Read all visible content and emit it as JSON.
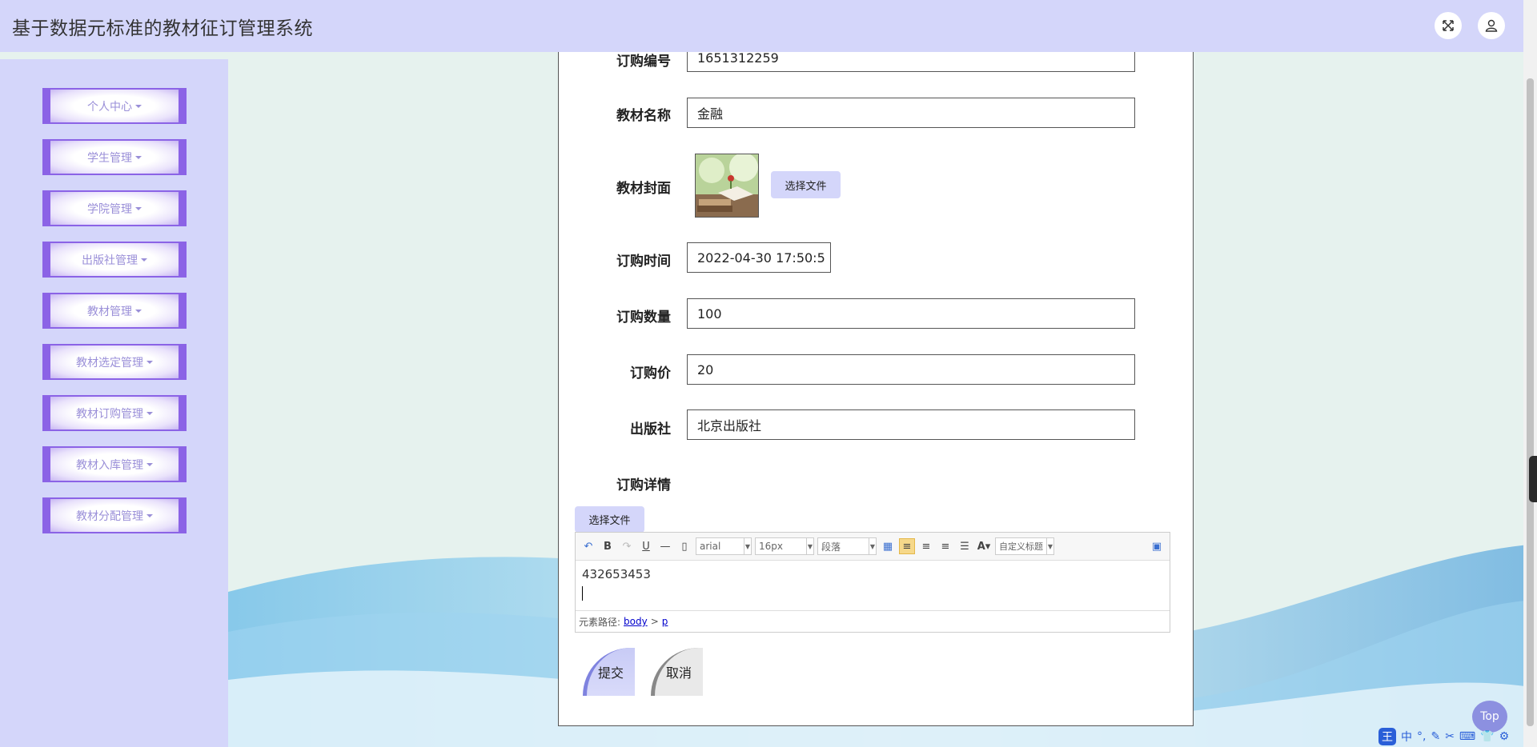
{
  "app": {
    "title": "基于数据元标准的教材征订管理系统"
  },
  "header": {
    "fullscreen_icon": "fullscreen-icon",
    "user_icon": "user-icon"
  },
  "sidebar": {
    "items": [
      {
        "label": "个人中心"
      },
      {
        "label": "学生管理"
      },
      {
        "label": "学院管理"
      },
      {
        "label": "出版社管理"
      },
      {
        "label": "教材管理"
      },
      {
        "label": "教材选定管理"
      },
      {
        "label": "教材订购管理"
      },
      {
        "label": "教材入库管理"
      },
      {
        "label": "教材分配管理"
      }
    ]
  },
  "form": {
    "order_no": {
      "label": "订购编号",
      "value": "1651312259"
    },
    "book_name": {
      "label": "教材名称",
      "value": "金融"
    },
    "cover": {
      "label": "教材封面",
      "button": "选择文件"
    },
    "order_time": {
      "label": "订购时间",
      "value": "2022-04-30 17:50:5"
    },
    "quantity": {
      "label": "订购数量",
      "value": "100"
    },
    "price": {
      "label": "订购价",
      "value": "20"
    },
    "publisher": {
      "label": "出版社",
      "value": "北京出版社"
    },
    "details": {
      "label": "订购详情",
      "button": "选择文件"
    }
  },
  "editor": {
    "font_family": "arial",
    "font_size": "16px",
    "paragraph": "段落",
    "custom_title": "自定义标题",
    "content": "432653453",
    "path_label": "元素路径:",
    "path_body": "body",
    "path_sep": ">",
    "path_p": "p"
  },
  "actions": {
    "submit": "提交",
    "cancel": "取消"
  },
  "top_button": "Top",
  "ime": {
    "chinese": "中",
    "logo": "王"
  },
  "colors": {
    "accent": "#d4d6fa",
    "menu_border": "#8b63e6"
  }
}
